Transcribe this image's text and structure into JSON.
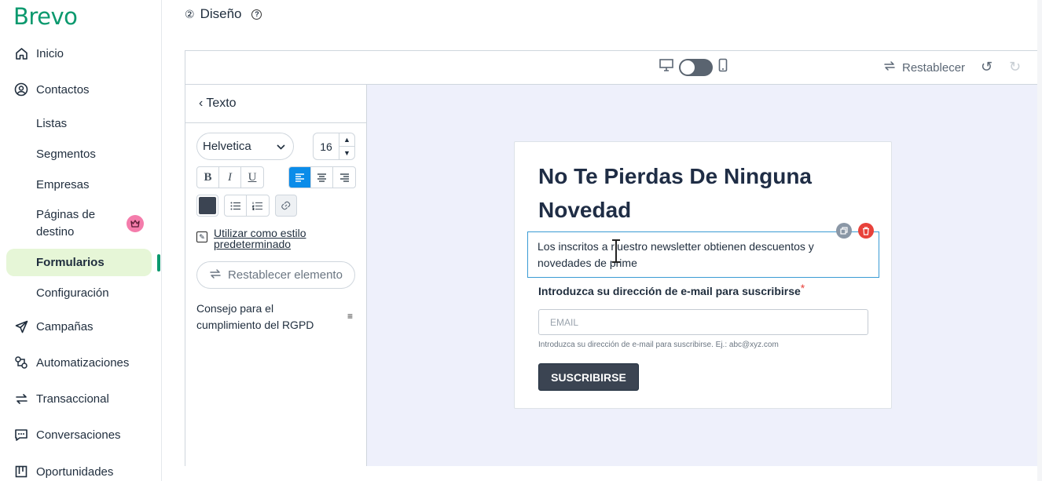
{
  "app": {
    "brand": "Brevo"
  },
  "sidebar": {
    "items": [
      {
        "label": "Inicio",
        "icon": "home-icon"
      },
      {
        "label": "Contactos",
        "icon": "contacts-icon"
      },
      {
        "label": "Campañas",
        "icon": "send-icon"
      },
      {
        "label": "Automatizaciones",
        "icon": "automation-icon"
      },
      {
        "label": "Transaccional",
        "icon": "transaction-icon"
      },
      {
        "label": "Conversaciones",
        "icon": "chat-icon"
      },
      {
        "label": "Oportunidades",
        "icon": "pipeline-icon"
      }
    ],
    "contact_sub": [
      "Listas",
      "Segmentos",
      "Empresas",
      "Páginas de destino",
      "Formularios",
      "Configuración"
    ],
    "active": "Formularios"
  },
  "header": {
    "step_number": "②",
    "step_title": "Diseño"
  },
  "toolbar": {
    "reset_label": "Restablecer"
  },
  "panel": {
    "back_label": "Texto",
    "font_family": "Helvetica",
    "font_size": "16",
    "default_style_label": "Utilizar como estilo predeterminado",
    "reset_element_label": "Restablecer elemento",
    "rgpd_label": "Consejo para el cumplimiento del RGPD"
  },
  "form": {
    "title": "No Te Pierdas De Ninguna Novedad",
    "description": "Los inscritos a nuestro newsletter obtienen descuentos y novedades de prime",
    "email_label": "Introduzca su dirección de e-mail para suscribirse",
    "required_mark": "*",
    "email_placeholder": "EMAIL",
    "email_hint": "Introduzca su dirección de e-mail para suscribirse. Ej.: abc@xyz.com",
    "submit_label": "SUSCRIBIRSE"
  },
  "colors": {
    "brand": "#0b996e",
    "active_bg": "#e6f6d7",
    "accent_blue": "#0b8ce9",
    "text_color_swatch": "#3b4452",
    "delete_red": "#e8423b"
  }
}
